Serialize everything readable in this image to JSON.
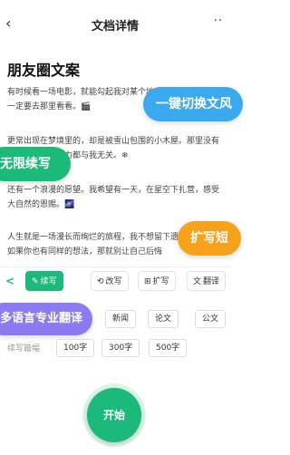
{
  "nav": {
    "back_icon": "back-arrow-icon",
    "back_glyph": "‹",
    "title": "文档详情",
    "more_glyph": "··"
  },
  "document": {
    "title": "朋友圈文案",
    "paragraphs": [
      "有时候看一场电影，就能勾起我对某个地方的向往，一天我一定要去那里看看。🎬",
      "更常出现在梦境里的，却是被雪山包围的小木屋。那里没有城市的喧嚣和压力都与我无关。❄",
      "还有一个浪漫的愿望。我希望有一天，在星空下扎营，感受大自然的恩赐。🌌",
      "人生就是一场漫长而绚烂的旅程，我不想留下遗憾的梦里。如果你也有同样的想法，那就别让自己后悔"
    ]
  },
  "feature_pills": {
    "one_click_switch": "一键切换文风",
    "unlimited_continue": "无限续写",
    "expand_short": "扩写短",
    "multilang_translate": "多语言专业翻译"
  },
  "toolbar": {
    "chevron": "<",
    "items": [
      {
        "label": "续写",
        "icon": "pen-icon",
        "glyph": "✎",
        "active": true
      },
      {
        "label": "改写",
        "icon": "refresh-icon",
        "glyph": "⟲",
        "active": false
      },
      {
        "label": "扩写",
        "icon": "expand-icon",
        "glyph": "⊞",
        "active": false
      },
      {
        "label": "翻译",
        "icon": "translate-icon",
        "glyph": "文",
        "active": false
      }
    ]
  },
  "style_options": [
    "新闻",
    "论文",
    "公文"
  ],
  "length": {
    "label": "续写篇幅",
    "options": [
      "100字",
      "300字",
      "500字"
    ]
  },
  "start_button": "开始",
  "colors": {
    "green": "#1bb97a",
    "blue": "#3aa9ee",
    "orange": "#f7a21a",
    "purple": "#8a7cf0"
  }
}
